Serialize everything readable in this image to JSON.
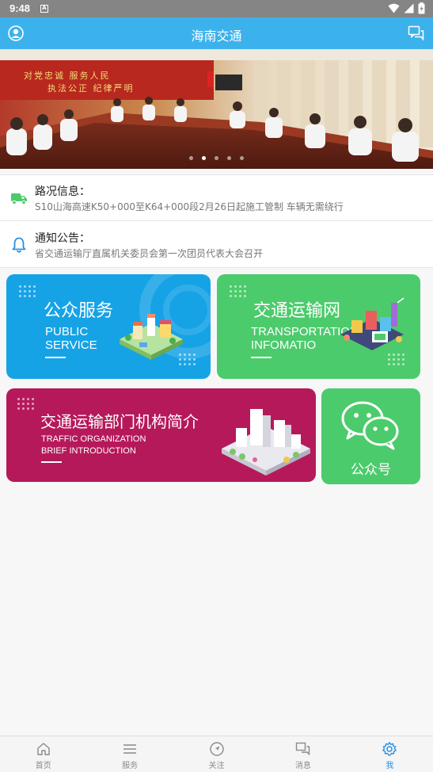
{
  "status_bar": {
    "time": "9:48",
    "notification_badge": "A"
  },
  "header": {
    "title": "海南交通"
  },
  "banner": {
    "slogan_line1": "对党忠诚 服务人民",
    "slogan_line2": "执法公正 纪律严明",
    "slide_count": 5,
    "active_slide": 2
  },
  "news": [
    {
      "heading": "路况信息：",
      "text": "S10山海高速K50+000至K64+000段2月26日起施工管制 车辆无需绕行",
      "icon": "truck-icon"
    },
    {
      "heading": "通知公告：",
      "text": "省交通运输厅直属机关委员会第一次团员代表大会召开",
      "icon": "bell-icon"
    }
  ],
  "cards": {
    "public_service": {
      "cn": "公众服务",
      "en_line1": "PUBLIC",
      "en_line2": "SERVICE"
    },
    "transport_network": {
      "cn": "交通运输网",
      "en_line1": "TRANSPORTATION",
      "en_line2": "INFOMATIO"
    },
    "org_intro": {
      "cn": "交通运输部门机构简介",
      "en_line1": "TRAFFIC  ORGANIZATION",
      "en_line2": "BRIEF INTRODUCTION"
    },
    "wechat": {
      "label": "公众号"
    }
  },
  "bottom_nav": [
    {
      "label": "首页",
      "icon": "home-icon"
    },
    {
      "label": "服务",
      "icon": "menu-icon"
    },
    {
      "label": "关注",
      "icon": "compass-icon"
    },
    {
      "label": "消息",
      "icon": "message-icon"
    },
    {
      "label": "我",
      "icon": "gear-icon",
      "active": true
    }
  ],
  "colors": {
    "header": "#3cb2ec",
    "public_card": "#15a3e6",
    "transport_card": "#4ccb6c",
    "org_card": "#b6195a",
    "wechat_card": "#4ccb6c",
    "nav_active": "#2a8fe0"
  }
}
